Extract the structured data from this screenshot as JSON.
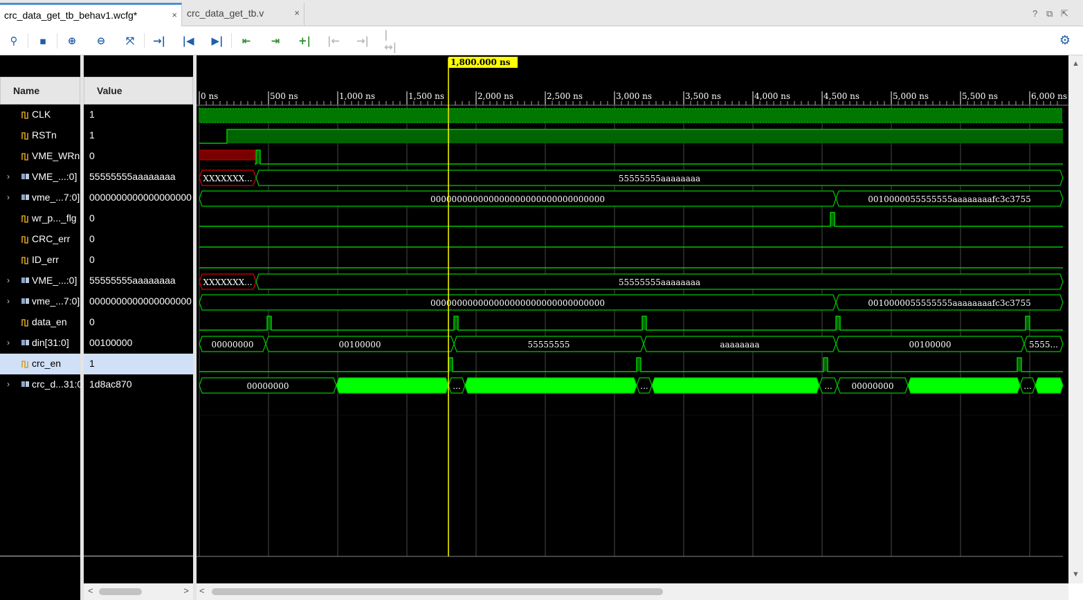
{
  "tabs": [
    {
      "label": "crc_data_get_tb_behav1.wcfg*",
      "close": "×"
    },
    {
      "label": "crc_data_get_tb.v",
      "close": "×"
    }
  ],
  "window_controls": [
    "?",
    "⧉",
    "⇱"
  ],
  "toolbar": {
    "icons": [
      "search-icon",
      "save-icon",
      "zoom-in-icon",
      "zoom-out-icon",
      "zoom-fit-icon",
      "go-to-cursor-icon",
      "go-to-time-0-icon",
      "go-to-last-time-icon",
      "previous-transition-icon",
      "next-transition-icon",
      "add-marker-icon",
      "previous-marker-icon",
      "next-marker-icon",
      "swap-cursors-icon"
    ]
  },
  "panel": {
    "name_header": "Name",
    "value_header": "Value"
  },
  "cursor": {
    "time_label": "1,800.000 ns",
    "time_ns": 1800
  },
  "timeline": {
    "ticks": [
      {
        "label": "0 ns",
        "t": 0
      },
      {
        "label": "500 ns",
        "t": 500
      },
      {
        "label": "1,000 ns",
        "t": 1000
      },
      {
        "label": "1,500 ns",
        "t": 1500
      },
      {
        "label": "2,000 ns",
        "t": 2000
      },
      {
        "label": "2,500 ns",
        "t": 2500
      },
      {
        "label": "3,000 ns",
        "t": 3000
      },
      {
        "label": "3,500 ns",
        "t": 3500
      },
      {
        "label": "4,000 ns",
        "t": 4000
      },
      {
        "label": "4,500 ns",
        "t": 4500
      },
      {
        "label": "5,000 ns",
        "t": 5000
      },
      {
        "label": "5,500 ns",
        "t": 5500
      },
      {
        "label": "6,000 ns",
        "t": 6000
      }
    ]
  },
  "signals": [
    {
      "name": "CLK",
      "value": "1",
      "expandable": false,
      "icon": "bit-signal-icon"
    },
    {
      "name": "RSTn",
      "value": "1",
      "expandable": false,
      "icon": "bit-signal-icon"
    },
    {
      "name": "VME_WRn",
      "value": "0",
      "expandable": false,
      "icon": "bit-signal-icon"
    },
    {
      "name": "VME_...:0]",
      "value": "55555555aaaaaaaa",
      "expandable": true,
      "icon": "bus-signal-icon"
    },
    {
      "name": "vme_...7:0]",
      "value": "0000000000000000000",
      "expandable": true,
      "icon": "bus-signal-icon"
    },
    {
      "name": "wr_p..._flg",
      "value": "0",
      "expandable": false,
      "icon": "bit-signal-icon"
    },
    {
      "name": "CRC_err",
      "value": "0",
      "expandable": false,
      "icon": "bit-signal-icon"
    },
    {
      "name": "ID_err",
      "value": "0",
      "expandable": false,
      "icon": "bit-signal-icon"
    },
    {
      "name": "VME_...:0]",
      "value": "55555555aaaaaaaa",
      "expandable": true,
      "icon": "bus-signal-icon"
    },
    {
      "name": "vme_...7:0]",
      "value": "0000000000000000000",
      "expandable": true,
      "icon": "bus-signal-icon"
    },
    {
      "name": "data_en",
      "value": "0",
      "expandable": false,
      "icon": "bit-signal-icon"
    },
    {
      "name": "din[31:0]",
      "value": "00100000",
      "expandable": true,
      "icon": "bus-signal-icon"
    },
    {
      "name": "crc_en",
      "value": "1",
      "expandable": false,
      "icon": "bit-signal-icon",
      "selected": true
    },
    {
      "name": "crc_d...31:0]",
      "value": "1d8ac870",
      "expandable": true,
      "icon": "bus-signal-icon"
    }
  ],
  "bus_labels": {
    "vme_in_a": [
      "XXXXXXX...",
      "55555555aaaaaaaa"
    ],
    "vme_out_a": [
      "000000000000000000000000000000000",
      "0010000055555555aaaaaaaafc3c3755"
    ],
    "vme_in_b": [
      "XXXXXXX...",
      "55555555aaaaaaaa"
    ],
    "vme_out_b": [
      "000000000000000000000000000000000",
      "0010000055555555aaaaaaaafc3c3755"
    ],
    "din": [
      "00000000",
      "00100000",
      "55555555",
      "aaaaaaaa",
      "00100000",
      "5555..."
    ],
    "crc": [
      "00000000",
      "...",
      "...",
      "...",
      "00000000",
      "..."
    ]
  }
}
